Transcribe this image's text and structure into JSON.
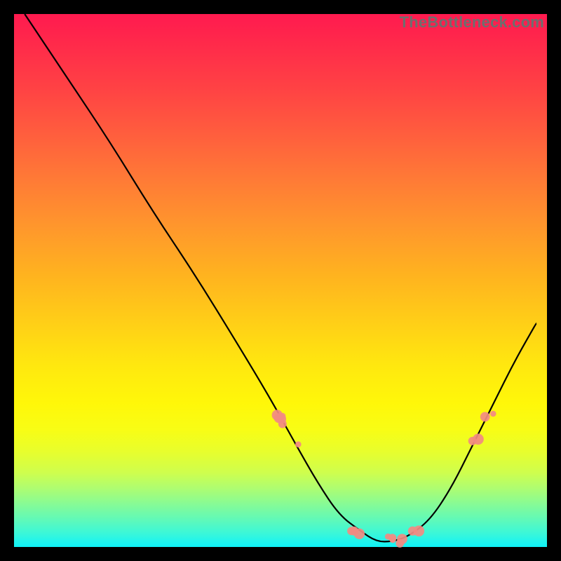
{
  "watermark": "TheBottleneck.com",
  "chart_data": {
    "type": "line",
    "title": "",
    "xlabel": "",
    "ylabel": "",
    "xlim": [
      0,
      100
    ],
    "ylim": [
      0,
      100
    ],
    "grid": false,
    "legend": false,
    "series": [
      {
        "name": "bottleneck-curve",
        "color": "#000000",
        "x": [
          2,
          10,
          18,
          26,
          34,
          42,
          48,
          53,
          57,
          61,
          65,
          68,
          71,
          74,
          78,
          82,
          86,
          90,
          94,
          98
        ],
        "y": [
          100,
          88,
          76,
          63,
          51,
          38,
          28,
          19,
          12,
          6,
          3,
          1,
          1,
          2,
          5,
          11,
          19,
          27,
          35,
          42
        ]
      }
    ],
    "marker_clusters": [
      {
        "name": "left-slope-markers",
        "color": "#f28b82",
        "x_range": [
          48,
          54
        ],
        "y_range": [
          18,
          30
        ],
        "count": 7
      },
      {
        "name": "valley-markers",
        "color": "#f28b82",
        "x_range": [
          62,
          78
        ],
        "y_range": [
          0.5,
          3
        ],
        "count": 11
      },
      {
        "name": "right-slope-markers",
        "color": "#f28b82",
        "x_range": [
          84,
          90
        ],
        "y_range": [
          16,
          25
        ],
        "count": 4
      }
    ],
    "background_gradient": {
      "direction": "vertical",
      "stops": [
        {
          "pos": 0.0,
          "color": "#ff1a4f"
        },
        {
          "pos": 0.5,
          "color": "#ffb31f"
        },
        {
          "pos": 0.75,
          "color": "#fff709"
        },
        {
          "pos": 0.92,
          "color": "#86fb96"
        },
        {
          "pos": 1.0,
          "color": "#10f2f6"
        }
      ]
    }
  }
}
